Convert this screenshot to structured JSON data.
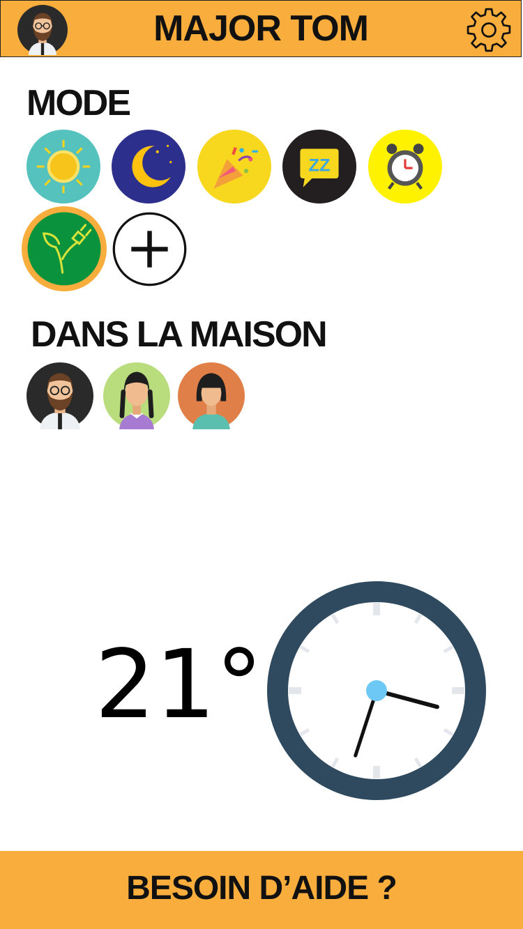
{
  "header": {
    "title": "MAJOR TOM",
    "avatar_icon": "bearded-man-avatar",
    "settings_icon": "gear-icon"
  },
  "mode": {
    "title": "MODE",
    "items": [
      {
        "icon": "sun-icon",
        "color": "#55c2bd"
      },
      {
        "icon": "moon-icon",
        "color": "#2d2f8c"
      },
      {
        "icon": "party-popper-icon",
        "color": "#f7d81f"
      },
      {
        "icon": "sleep-zz-icon",
        "color": "#231f20"
      },
      {
        "icon": "alarm-clock-icon",
        "color": "#fff200"
      },
      {
        "icon": "eco-plug-icon",
        "color": "#0a923c",
        "selected": true
      },
      {
        "icon": "plus-icon",
        "color": "#ffffff"
      }
    ],
    "selected_ring_color": "#f9ad3c"
  },
  "home": {
    "title": "DANS LA MAISON",
    "people": [
      {
        "icon": "bearded-man-avatar",
        "color": "#2a2a2a"
      },
      {
        "icon": "girl-braids-avatar",
        "color": "#b9dd7c"
      },
      {
        "icon": "woman-bob-avatar",
        "color": "#e07f47"
      }
    ]
  },
  "temperature": "21°",
  "clock": {
    "hour": 3.5,
    "minute": 33,
    "frame_color": "#2f4a5f",
    "center_color": "#6ec8f5"
  },
  "footer": {
    "label": "BESOIN D’AIDE ?"
  },
  "colors": {
    "accent": "#f9ad3c"
  }
}
